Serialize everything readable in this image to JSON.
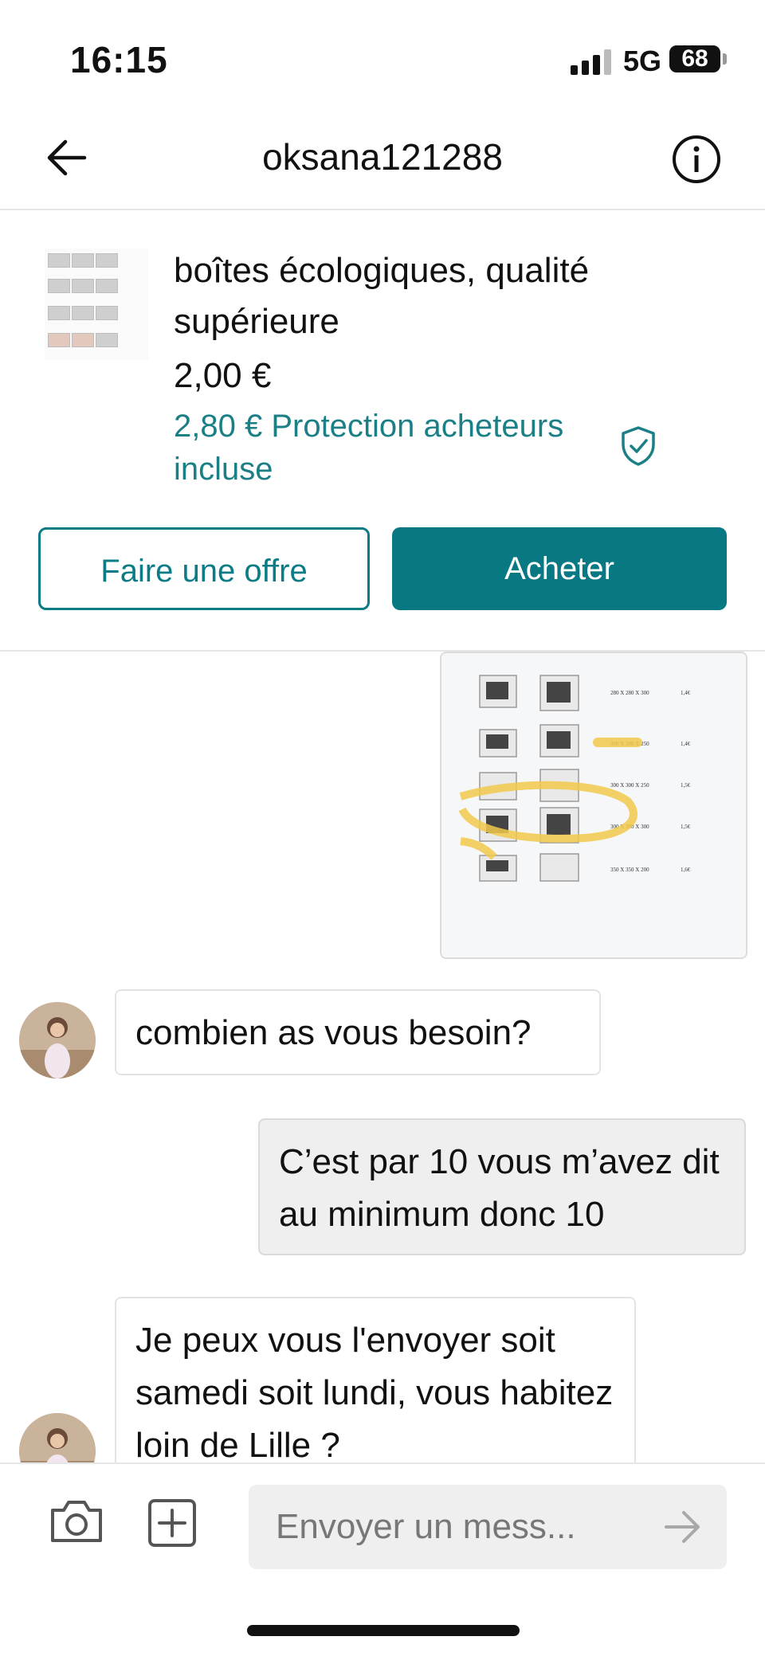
{
  "status": {
    "time": "16:15",
    "network": "5G",
    "battery": "68"
  },
  "header": {
    "username": "oksana121288"
  },
  "item": {
    "title": "boîtes écologiques, qualité supérieure",
    "price": "2,00 €",
    "protection": "2,80 € Protection acheteurs incluse",
    "offer_label": "Faire une offre",
    "buy_label": "Acheter"
  },
  "photo_prices": [
    {
      "size": "280 X 280 X 300",
      "price": "1,4€"
    },
    {
      "size": "300 X 300 X 250",
      "price": "1,4€"
    },
    {
      "size": "300 X 300 X 250",
      "price": "1,5€"
    },
    {
      "size": "300 X 300 X 300",
      "price": "1,5€"
    },
    {
      "size": "350 X 350 X 200",
      "price": "1,6€"
    }
  ],
  "messages": [
    {
      "from": "other",
      "text": "combien as vous besoin?"
    },
    {
      "from": "me",
      "text": "C’est par 10 vous m’avez dit au minimum donc 10"
    },
    {
      "from": "other",
      "text": "Je peux vous l'envoyer soit samedi soit lundi, vous habitez loin de Lille ?"
    }
  ],
  "composer": {
    "placeholder": "Envoyer un mess..."
  },
  "colors": {
    "accent": "#087882",
    "accent_text": "#1b7f86",
    "highlight": "#f2c94c"
  },
  "icons": [
    "back-arrow-icon",
    "info-icon",
    "shield-check-icon",
    "camera-icon",
    "add-square-icon",
    "send-arrow-icon"
  ]
}
